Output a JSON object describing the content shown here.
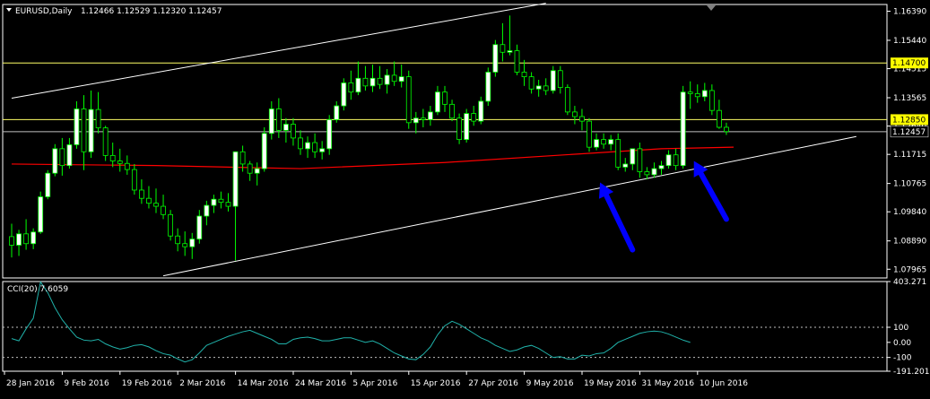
{
  "header": {
    "symbol_label": "EURUSD,Daily",
    "ohlc_text": "1.12466 1.12529 1.12320 1.12457",
    "indicator_label": "CCI(20) 7.6059"
  },
  "colors": {
    "background": "#000000",
    "bull_candle": "#ffffff",
    "bear_candle": "#000000",
    "wick_outline": "#00ff00",
    "moving_average": "#ff0000",
    "trendline": "#ffffff",
    "level_line": "#ffff66",
    "bid_line": "#c0c0c0",
    "cci_line": "#20b2aa",
    "cci_levels": "#c0c0c0",
    "arrow": "#0000ff",
    "label_highlight": "#ffff00",
    "axis_text": "#ffffff",
    "frame": "#ffffff"
  },
  "chart_data": {
    "type": "candlestick",
    "title": "EURUSD,Daily",
    "price_ylim": [
      1.0768,
      1.1661
    ],
    "price_ticks": [
      "1.16390",
      "1.15440",
      "1.14515",
      "1.13565",
      "1.12640",
      "1.11715",
      "1.10765",
      "1.09840",
      "1.08890",
      "1.07965"
    ],
    "price_tick_values": [
      1.1639,
      1.1544,
      1.14515,
      1.13565,
      1.1264,
      1.11715,
      1.10765,
      1.0984,
      1.0889,
      1.07965
    ],
    "highlighted_levels": [
      {
        "label": "1.14700",
        "value": 1.147
      },
      {
        "label": "1.12850",
        "value": 1.1285
      }
    ],
    "current_price": {
      "label": "1.12457",
      "value": 1.12457
    },
    "date_labels": [
      "28 Jan 2016",
      "9 Feb 2016",
      "19 Feb 2016",
      "2 Mar 2016",
      "14 Mar 2016",
      "24 Mar 2016",
      "5 Apr 2016",
      "15 Apr 2016",
      "27 Apr 2016",
      "9 May 2016",
      "19 May 2016",
      "31 May 2016",
      "10 Jun 2016"
    ],
    "date_label_bar_index": [
      0,
      8,
      16,
      24,
      32,
      40,
      48,
      56,
      64,
      72,
      80,
      88,
      96
    ],
    "candles": [
      [
        1.0903,
        1.0945,
        1.0835,
        1.0875
      ],
      [
        1.0875,
        1.0925,
        1.084,
        1.0912
      ],
      [
        1.0912,
        1.096,
        1.086,
        1.088
      ],
      [
        1.088,
        1.093,
        1.0862,
        1.0918
      ],
      [
        1.0918,
        1.105,
        1.0912,
        1.1033
      ],
      [
        1.1033,
        1.112,
        1.1025,
        1.111
      ],
      [
        1.111,
        1.1205,
        1.11,
        1.119
      ],
      [
        1.119,
        1.1225,
        1.1102,
        1.1135
      ],
      [
        1.1135,
        1.1225,
        1.1125,
        1.1203
      ],
      [
        1.1203,
        1.1345,
        1.119,
        1.132
      ],
      [
        1.132,
        1.1365,
        1.112,
        1.118
      ],
      [
        1.118,
        1.138,
        1.116,
        1.1318
      ],
      [
        1.1318,
        1.1375,
        1.124,
        1.1258
      ],
      [
        1.1258,
        1.1265,
        1.115,
        1.1168
      ],
      [
        1.1168,
        1.121,
        1.113,
        1.115
      ],
      [
        1.115,
        1.119,
        1.1115,
        1.1142
      ],
      [
        1.1142,
        1.1168,
        1.1105,
        1.1122
      ],
      [
        1.1122,
        1.114,
        1.104,
        1.1055
      ],
      [
        1.1055,
        1.109,
        1.101,
        1.1028
      ],
      [
        1.1028,
        1.1068,
        1.0995,
        1.1012
      ],
      [
        1.1012,
        1.106,
        1.098,
        1.1002
      ],
      [
        1.1002,
        1.104,
        1.096,
        1.0975
      ],
      [
        1.0975,
        1.099,
        1.089,
        1.0905
      ],
      [
        1.0905,
        1.093,
        1.0855,
        1.088
      ],
      [
        1.088,
        1.092,
        1.084,
        1.087
      ],
      [
        1.087,
        1.0915,
        1.083,
        1.0895
      ],
      [
        1.0895,
        1.099,
        1.088,
        1.097
      ],
      [
        1.097,
        1.102,
        1.094,
        1.1005
      ],
      [
        1.1005,
        1.104,
        1.098,
        1.1025
      ],
      [
        1.1025,
        1.105,
        1.0995,
        1.1015
      ],
      [
        1.1015,
        1.1045,
        1.0985,
        1.1002
      ],
      [
        1.1002,
        1.107,
        1.0825,
        1.118
      ],
      [
        1.118,
        1.12,
        1.1115,
        1.114
      ],
      [
        1.114,
        1.115,
        1.1085,
        1.111
      ],
      [
        1.111,
        1.1145,
        1.107,
        1.1125
      ],
      [
        1.1125,
        1.126,
        1.1115,
        1.124
      ],
      [
        1.124,
        1.1345,
        1.122,
        1.132
      ],
      [
        1.132,
        1.1355,
        1.1225,
        1.125
      ],
      [
        1.125,
        1.129,
        1.121,
        1.127
      ],
      [
        1.127,
        1.129,
        1.12,
        1.1225
      ],
      [
        1.1225,
        1.125,
        1.117,
        1.119
      ],
      [
        1.119,
        1.123,
        1.116,
        1.121
      ],
      [
        1.121,
        1.124,
        1.116,
        1.118
      ],
      [
        1.118,
        1.1215,
        1.1155,
        1.119
      ],
      [
        1.119,
        1.13,
        1.117,
        1.1285
      ],
      [
        1.1285,
        1.1345,
        1.1275,
        1.133
      ],
      [
        1.133,
        1.142,
        1.1315,
        1.1405
      ],
      [
        1.1405,
        1.1445,
        1.135,
        1.1375
      ],
      [
        1.1375,
        1.1475,
        1.1365,
        1.142
      ],
      [
        1.142,
        1.146,
        1.138,
        1.1395
      ],
      [
        1.1395,
        1.1465,
        1.1375,
        1.142
      ],
      [
        1.142,
        1.146,
        1.1385,
        1.14
      ],
      [
        1.14,
        1.145,
        1.137,
        1.143
      ],
      [
        1.143,
        1.1475,
        1.1395,
        1.141
      ],
      [
        1.141,
        1.1465,
        1.139,
        1.1425
      ],
      [
        1.1425,
        1.1445,
        1.1255,
        1.1275
      ],
      [
        1.1275,
        1.131,
        1.124,
        1.129
      ],
      [
        1.129,
        1.132,
        1.126,
        1.1285
      ],
      [
        1.1285,
        1.133,
        1.1265,
        1.131
      ],
      [
        1.131,
        1.1395,
        1.13,
        1.1375
      ],
      [
        1.1375,
        1.1395,
        1.131,
        1.1335
      ],
      [
        1.1335,
        1.135,
        1.128,
        1.129
      ],
      [
        1.129,
        1.1305,
        1.1205,
        1.122
      ],
      [
        1.122,
        1.132,
        1.121,
        1.1305
      ],
      [
        1.1305,
        1.133,
        1.1265,
        1.128
      ],
      [
        1.128,
        1.136,
        1.127,
        1.1345
      ],
      [
        1.1345,
        1.1455,
        1.133,
        1.144
      ],
      [
        1.144,
        1.1545,
        1.1425,
        1.153
      ],
      [
        1.153,
        1.16,
        1.1475,
        1.1505
      ],
      [
        1.1505,
        1.1625,
        1.1495,
        1.151
      ],
      [
        1.151,
        1.153,
        1.143,
        1.144
      ],
      [
        1.144,
        1.148,
        1.1395,
        1.1425
      ],
      [
        1.1425,
        1.144,
        1.137,
        1.1385
      ],
      [
        1.1385,
        1.1415,
        1.136,
        1.1395
      ],
      [
        1.1395,
        1.142,
        1.1365,
        1.138
      ],
      [
        1.138,
        1.146,
        1.137,
        1.1445
      ],
      [
        1.1445,
        1.146,
        1.137,
        1.139
      ],
      [
        1.139,
        1.14,
        1.13,
        1.131
      ],
      [
        1.131,
        1.133,
        1.127,
        1.1295
      ],
      [
        1.1295,
        1.132,
        1.125,
        1.128
      ],
      [
        1.128,
        1.129,
        1.118,
        1.1195
      ],
      [
        1.1195,
        1.124,
        1.1185,
        1.122
      ],
      [
        1.122,
        1.124,
        1.119,
        1.1205
      ],
      [
        1.1205,
        1.1235,
        1.1185,
        1.122
      ],
      [
        1.122,
        1.124,
        1.112,
        1.113
      ],
      [
        1.113,
        1.116,
        1.1115,
        1.114
      ],
      [
        1.114,
        1.115,
        1.112,
        1.119
      ],
      [
        1.119,
        1.121,
        1.1095,
        1.1115
      ],
      [
        1.1115,
        1.113,
        1.109,
        1.1105
      ],
      [
        1.1105,
        1.1145,
        1.1095,
        1.1125
      ],
      [
        1.1125,
        1.115,
        1.1105,
        1.1135
      ],
      [
        1.1135,
        1.1185,
        1.1125,
        1.117
      ],
      [
        1.117,
        1.119,
        1.112,
        1.1135
      ],
      [
        1.1135,
        1.1395,
        1.1125,
        1.1375
      ],
      [
        1.1375,
        1.141,
        1.132,
        1.137
      ],
      [
        1.137,
        1.14,
        1.134,
        1.136
      ],
      [
        1.136,
        1.1405,
        1.1345,
        1.138
      ],
      [
        1.138,
        1.14,
        1.13,
        1.1315
      ],
      [
        1.1315,
        1.135,
        1.1255,
        1.126
      ],
      [
        1.126,
        1.1275,
        1.1235,
        1.1246
      ]
    ],
    "moving_average": [
      [
        0,
        1.114
      ],
      [
        20,
        1.1135
      ],
      [
        40,
        1.1125
      ],
      [
        60,
        1.1145
      ],
      [
        80,
        1.1175
      ],
      [
        90,
        1.119
      ],
      [
        100,
        1.1195
      ]
    ],
    "trendlines": [
      {
        "name": "upper-channel",
        "points": [
          [
            0,
            1.1355
          ],
          [
            74,
            1.1665
          ]
        ]
      },
      {
        "name": "lower-channel",
        "points": [
          [
            21,
            1.0775
          ],
          [
            117,
            1.123
          ]
        ]
      }
    ],
    "cci": {
      "label": "CCI(20) 7.6059",
      "value": 7.6059,
      "ylim": [
        -191.2012,
        403.271
      ],
      "tick_labels": [
        "403.271",
        "100",
        "0.00",
        "-100",
        "-191.2012"
      ],
      "tick_values": [
        403.271,
        100,
        0,
        -100,
        -191.2012
      ],
      "levels": [
        100,
        -100
      ],
      "values": [
        25,
        10,
        90,
        160,
        400,
        330,
        230,
        150,
        90,
        35,
        15,
        10,
        20,
        -10,
        -30,
        -45,
        -35,
        -20,
        -15,
        -30,
        -55,
        -75,
        -85,
        -110,
        -130,
        -115,
        -70,
        -20,
        0,
        20,
        40,
        55,
        70,
        80,
        60,
        40,
        20,
        -10,
        -10,
        20,
        30,
        35,
        25,
        10,
        10,
        20,
        30,
        30,
        15,
        0,
        10,
        -10,
        -40,
        -70,
        -90,
        -110,
        -115,
        -80,
        -30,
        50,
        110,
        140,
        120,
        90,
        60,
        30,
        10,
        -20,
        -40,
        -60,
        -50,
        -30,
        -20,
        -40,
        -70,
        -100,
        -95,
        -110,
        -110,
        -85,
        -90,
        -75,
        -70,
        -40,
        0,
        20,
        40,
        60,
        70,
        75,
        70,
        55,
        35,
        15,
        0
      ]
    }
  },
  "annotations": {
    "arrows": [
      {
        "name": "first",
        "from": [
          86,
          1.086
        ],
        "to": [
          81.5,
          1.108
        ]
      },
      {
        "name": "second",
        "from": [
          99,
          1.096
        ],
        "to": [
          94.5,
          1.115
        ]
      }
    ]
  }
}
